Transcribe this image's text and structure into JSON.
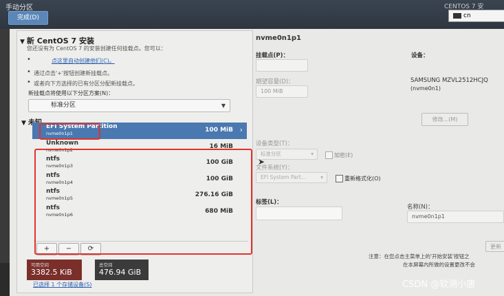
{
  "header": {
    "title": "手动分区",
    "done_label": "完成(D)",
    "installer_title": "CENTOS 7 安",
    "language": "cn"
  },
  "left": {
    "section_title": "新 CentOS 7 安装",
    "desc": "您还没有为 CentOS 7 的安装创建任何挂载点。您可以：",
    "auto_link": "点这里自动创建他们(C)。",
    "bullet1": "通过点击'+'按钮创建新挂载点。",
    "bullet2": "或者向下方选择的已有分区分配新挂载点。",
    "scheme_label": "新挂载点将使用以下分区方案(N)：",
    "scheme_value": "标准分区",
    "system_header": "未知",
    "partitions": [
      {
        "name": "EFI System Partition",
        "device": "nvme0n1p1",
        "size": "100 MiB",
        "selected": true
      },
      {
        "name": "Unknown",
        "device": "nvme0n1p2",
        "size": "16 MiB",
        "selected": false
      },
      {
        "name": "ntfs",
        "device": "nvme0n1p3",
        "size": "100 GiB",
        "selected": false
      },
      {
        "name": "ntfs",
        "device": "nvme0n1p4",
        "size": "100 GiB",
        "selected": false
      },
      {
        "name": "ntfs",
        "device": "nvme0n1p5",
        "size": "276.16 GiB",
        "selected": false
      },
      {
        "name": "ntfs",
        "device": "nvme0n1p6",
        "size": "680 MiB",
        "selected": false
      }
    ],
    "buttons": {
      "add": "+",
      "remove": "−",
      "refresh": "⟳"
    },
    "available_label": "可用空间",
    "available_value": "3382.5 KiB",
    "total_label": "总空间",
    "total_value": "476.94 GiB",
    "storage_link": "已选择 1 个存储设备(S)"
  },
  "right": {
    "title": "nvme0n1p1",
    "mount_label": "挂载点(P)：",
    "devices_label": "设备：",
    "capacity_label": "期望容量(D)：",
    "capacity_value": "100 MiB",
    "device_name": "SAMSUNG MZVL2512HCJQ",
    "device_id": "(nvme0n1)",
    "modify_label": "修改...(M)",
    "device_type_label": "设备类型(T)：",
    "device_type_value": "标准分区",
    "encrypt_label": "加密(E)",
    "filesystem_label": "文件系统(Y)：",
    "filesystem_value": "EFI System Part...",
    "reformat_label": "重新格式化(O)",
    "tag_label": "标签(L)：",
    "name_label": "名称(N)：",
    "name_value": "nvme0n1p1",
    "update_label": "更新设",
    "note1": "注意：在您点击主菜单上的'开始安装'按钮之",
    "note2": "在本屏幕内所做的设置更改不会"
  },
  "watermark": "CSDN @软测小唐",
  "colors": {
    "selected_row": "#4a78b0",
    "highlight_border": "#e0332d",
    "available_bg": "#7a2f2a",
    "total_bg": "#3b3b3b"
  }
}
